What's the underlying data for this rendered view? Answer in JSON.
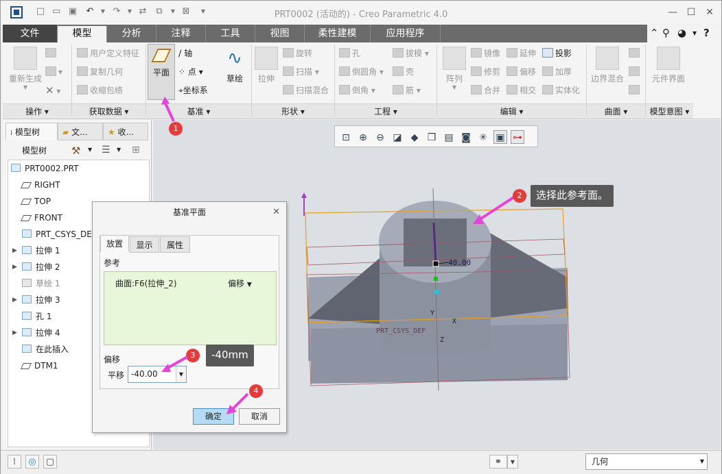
{
  "window": {
    "title": "PRT0002 (活动的) - Creo Parametric 4.0"
  },
  "ribbon_tabs": [
    "文件",
    "模型",
    "分析",
    "注释",
    "工具",
    "视图",
    "柔性建模",
    "应用程序"
  ],
  "groups": {
    "ops": "操作",
    "getdata": "获取数据",
    "datum": "基准",
    "shape": "形状",
    "eng": "工程",
    "edit": "编辑",
    "surface": "曲面",
    "intent": "模型意图"
  },
  "ribbon": {
    "regen": "重新生成",
    "udf": "用户定义特征",
    "copygeom": "复制几何",
    "shrinkwrap": "收缩包络",
    "plane": "平面",
    "axis": "轴",
    "point": "点",
    "csys": "坐标系",
    "sketch": "草绘",
    "extrude": "拉伸",
    "revolve": "旋转",
    "sweep": "扫描",
    "sweepblend": "扫描混合",
    "hole": "孔",
    "draft": "拔模",
    "round": "倒圆角",
    "shell": "壳",
    "chamfer": "倒角",
    "rib": "筋",
    "mirror": "镜像",
    "extend": "延伸",
    "project": "投影",
    "trim": "修剪",
    "offset": "偏移",
    "thicken": "加厚",
    "merge": "合并",
    "intersect": "相交",
    "solidify": "实体化",
    "pattern": "阵列",
    "boundary": "边界混合",
    "element": "元件界面"
  },
  "panel": {
    "tab_model": "模型树",
    "tab_files": "文...",
    "tab_fav": "收...",
    "header": "模型树"
  },
  "tree": [
    {
      "label": "PRT0002.PRT",
      "indent": 0,
      "expand": false,
      "dim": false
    },
    {
      "label": "RIGHT",
      "indent": 1,
      "expand": false,
      "dim": false
    },
    {
      "label": "TOP",
      "indent": 1,
      "expand": false,
      "dim": false
    },
    {
      "label": "FRONT",
      "indent": 1,
      "expand": false,
      "dim": false
    },
    {
      "label": "PRT_CSYS_DEF",
      "indent": 1,
      "expand": false,
      "dim": false
    },
    {
      "label": "拉伸 1",
      "indent": 1,
      "expand": true,
      "dim": false
    },
    {
      "label": "拉伸 2",
      "indent": 1,
      "expand": true,
      "dim": false
    },
    {
      "label": "草绘 1",
      "indent": 1,
      "expand": false,
      "dim": true
    },
    {
      "label": "拉伸 3",
      "indent": 1,
      "expand": true,
      "dim": false
    },
    {
      "label": "孔 1",
      "indent": 1,
      "expand": false,
      "dim": false
    },
    {
      "label": "拉伸 4",
      "indent": 1,
      "expand": true,
      "dim": false
    },
    {
      "label": "在此插入",
      "indent": 1,
      "expand": false,
      "dim": false
    },
    {
      "label": "DTM1",
      "indent": 1,
      "expand": false,
      "dim": false
    }
  ],
  "dialog": {
    "title": "基准平面",
    "tab_place": "放置",
    "tab_display": "显示",
    "tab_props": "属性",
    "ref_label": "参考",
    "ref_item": "曲面:F6(拉伸_2)",
    "ref_mode": "偏移",
    "offset_label": "偏移",
    "translate_label": "平移",
    "offset_value": "-40.00",
    "ok": "确定",
    "cancel": "取消"
  },
  "callouts": {
    "c2": "选择此参考面。",
    "c3": "-40mm"
  },
  "steps": [
    "1",
    "2",
    "3",
    "4"
  ],
  "model": {
    "dim_text": "40.00",
    "csys": "PRT_CSYS_DEF",
    "ax_x": "X",
    "ax_y": "Y",
    "ax_z": "Z"
  },
  "status": {
    "filter": "几何"
  }
}
